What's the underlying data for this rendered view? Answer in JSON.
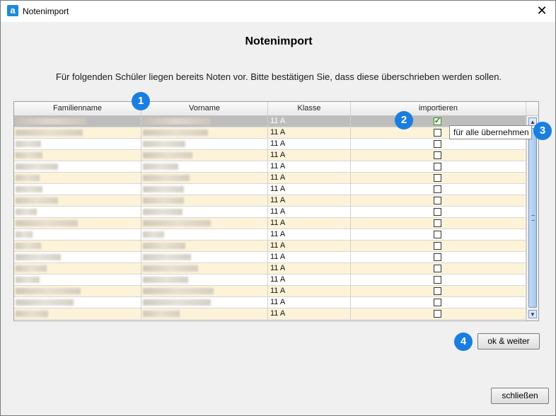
{
  "window": {
    "title": "Notenimport",
    "app_icon": "a",
    "close_glyph": "✕"
  },
  "heading": "Notenimport",
  "message": "Für folgenden Schüler liegen bereits Noten vor. Bitte bestätigen Sie, dass diese überschrieben werden sollen.",
  "table": {
    "columns": [
      "Familienname",
      "Vorname",
      "Klasse",
      "importieren"
    ],
    "rows": [
      {
        "klasse": "11 A",
        "checked": true,
        "selected": true
      },
      {
        "klasse": "11 A",
        "checked": false
      },
      {
        "klasse": "11 A",
        "checked": false
      },
      {
        "klasse": "11 A",
        "checked": false
      },
      {
        "klasse": "11 A",
        "checked": false
      },
      {
        "klasse": "11 A",
        "checked": false
      },
      {
        "klasse": "11 A",
        "checked": false
      },
      {
        "klasse": "11 A",
        "checked": false
      },
      {
        "klasse": "11 A",
        "checked": false
      },
      {
        "klasse": "11 A",
        "checked": false
      },
      {
        "klasse": "11 A",
        "checked": false
      },
      {
        "klasse": "11 A",
        "checked": false
      },
      {
        "klasse": "11 A",
        "checked": false
      },
      {
        "klasse": "11 A",
        "checked": false
      },
      {
        "klasse": "11 A",
        "checked": false
      },
      {
        "klasse": "11 A",
        "checked": false
      },
      {
        "klasse": "11 A",
        "checked": false
      },
      {
        "klasse": "11 A",
        "checked": false
      }
    ]
  },
  "tooltip": "für alle übernehmen",
  "badges": [
    "1",
    "2",
    "3",
    "4"
  ],
  "buttons": {
    "ok": "ok & weiter",
    "close": "schließen"
  },
  "scrollbar": {
    "up": "▲",
    "down": "▼"
  },
  "colors": {
    "row_alt": "#fdf3d9",
    "badge": "#1a7ee0",
    "selected_row": "#bdbdbd"
  }
}
